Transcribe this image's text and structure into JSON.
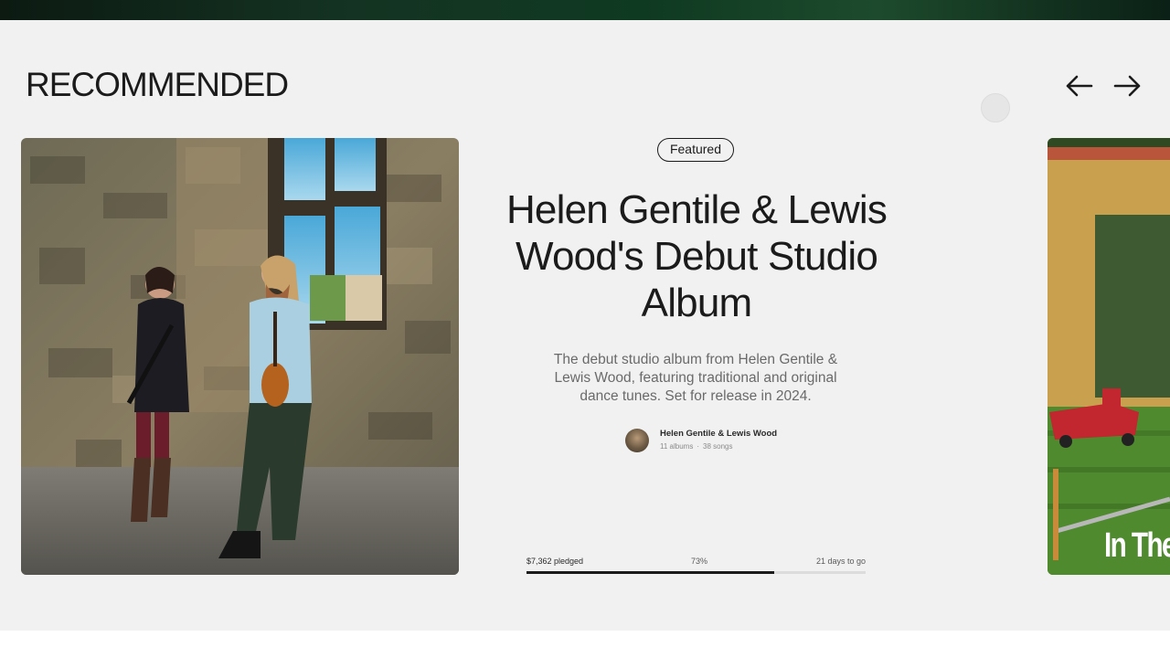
{
  "section": {
    "title": "RECOMMENDED"
  },
  "navigation": {
    "prev_icon": "arrow-left-icon",
    "next_icon": "arrow-right-icon"
  },
  "featured_project": {
    "badge": "Featured",
    "title": "Helen Gentile & Lewis Wood's Debut Studio Album",
    "description": "The debut studio album from Helen Gentile & Lewis Wood, featuring traditional and original dance tunes. Set for release in 2024.",
    "artist": {
      "name": "Helen Gentile & Lewis Wood",
      "albums": "11 albums",
      "separator": "·",
      "songs": "38 songs"
    },
    "funding": {
      "pledged": "$7,362 pledged",
      "percent_label": "73%",
      "percent_value": 0.73,
      "days_left": "21 days to go"
    }
  },
  "next_card": {
    "title": "In The"
  },
  "colors": {
    "section_bg": "#f1f1f1",
    "text_primary": "#1b1b1b",
    "text_muted": "#6a6a6a",
    "progress_track": "#dcdcdc",
    "progress_fill": "#1b1b1b",
    "top_strip": "#143322"
  }
}
